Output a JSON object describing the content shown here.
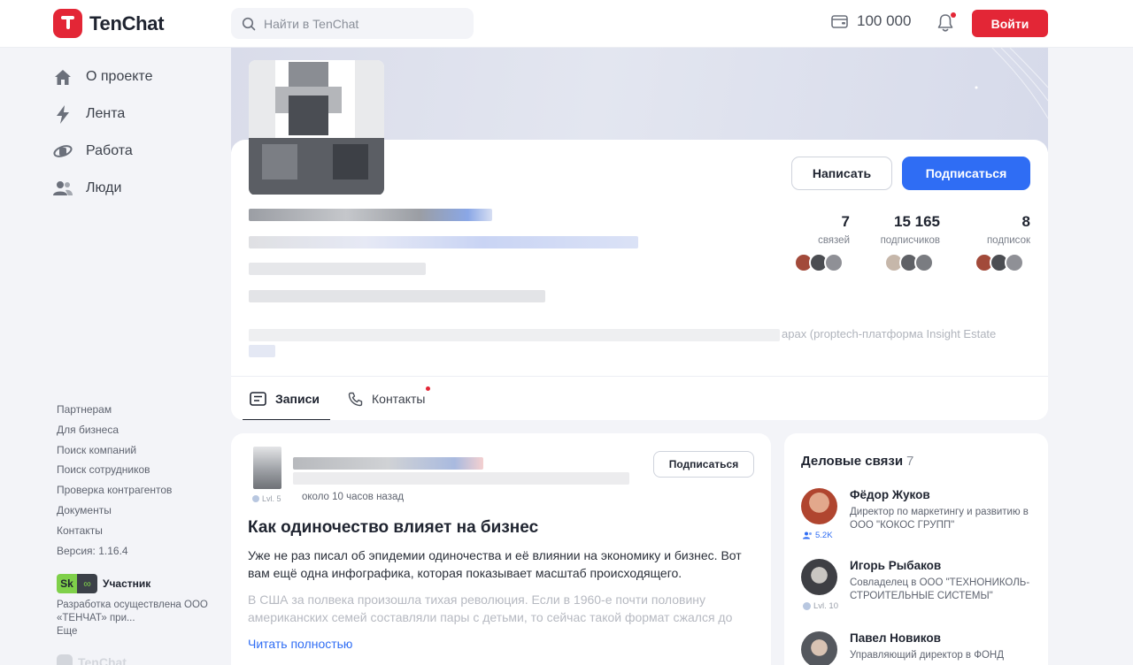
{
  "header": {
    "brand": "TenChat",
    "search_placeholder": "Найти в TenChat",
    "balance": "100 000",
    "login_label": "Войти"
  },
  "nav": {
    "items": [
      {
        "label": "О проекте",
        "icon": "home-icon"
      },
      {
        "label": "Лента",
        "icon": "lightning-icon"
      },
      {
        "label": "Работа",
        "icon": "briefcase-icon"
      },
      {
        "label": "Люди",
        "icon": "people-icon"
      }
    ]
  },
  "footer": {
    "links": [
      "Партнерам",
      "Для бизнеса",
      "Поиск компаний",
      "Поиск сотрудников",
      "Проверка контрагентов",
      "Документы",
      "Контакты",
      "Версия: 1.16.4"
    ],
    "sk_left": "Sk",
    "sk_right": "∞",
    "sk_label": "Участник",
    "dev_text": "Разработка осуществлена ООО «ТЕНЧАТ» при...",
    "more": "Еще",
    "brand": "TenChat"
  },
  "profile": {
    "write_label": "Написать",
    "subscribe_label": "Подписаться",
    "stats": [
      {
        "value": "7",
        "label": "связей"
      },
      {
        "value": "15 165",
        "label": "подписчиков"
      },
      {
        "value": "8",
        "label": "подписок"
      }
    ],
    "bio_visible": "арах (proptech-платформа Insight Estate",
    "tabs": [
      {
        "label": "Записи",
        "icon": "list-icon"
      },
      {
        "label": "Контакты",
        "icon": "phone-icon"
      }
    ]
  },
  "post": {
    "subscribe_label": "Подписаться",
    "level": "Lvl. 5",
    "time": "около 10 часов назад",
    "title": "Как одиночество влияет на бизнес",
    "lead": "Уже не раз писал об эпидемии одиночества и её влиянии на экономику и бизнес. Вот вам ещё одна инфографика, которая показывает масштаб происходящего.",
    "body": "В США за полвека произошла тихая революция. Если в 1960-е почти половину американских семей составляли пары с детьми, то сейчас такой формат сжался до",
    "read_more": "Читать полностью"
  },
  "connections": {
    "title": "Деловые связи",
    "count": "7",
    "people": [
      {
        "name": "Фёдор Жуков",
        "role": "Директор по маркетингу и развитию в ООО \"КОКОС ГРУПП\"",
        "meta": "5.2K",
        "meta_icon": "people-small-icon",
        "avatar_color": "#b0452f"
      },
      {
        "name": "Игорь Рыбаков",
        "role": "Совладелец в ООО \"ТЕХНОНИКОЛЬ-СТРОИТЕЛЬНЫЕ СИСТЕМЫ\"",
        "meta": "Lvl. 10",
        "meta_icon": "level-icon",
        "avatar_color": "#3e3f44"
      },
      {
        "name": "Павел Новиков",
        "role": "Управляющий директор в ФОНД",
        "meta": "",
        "meta_icon": "",
        "avatar_color": "#55585e"
      }
    ]
  },
  "colors": {
    "brand_red": "#e32636",
    "accent_blue": "#2f6df4",
    "background": "#f3f4f8"
  }
}
